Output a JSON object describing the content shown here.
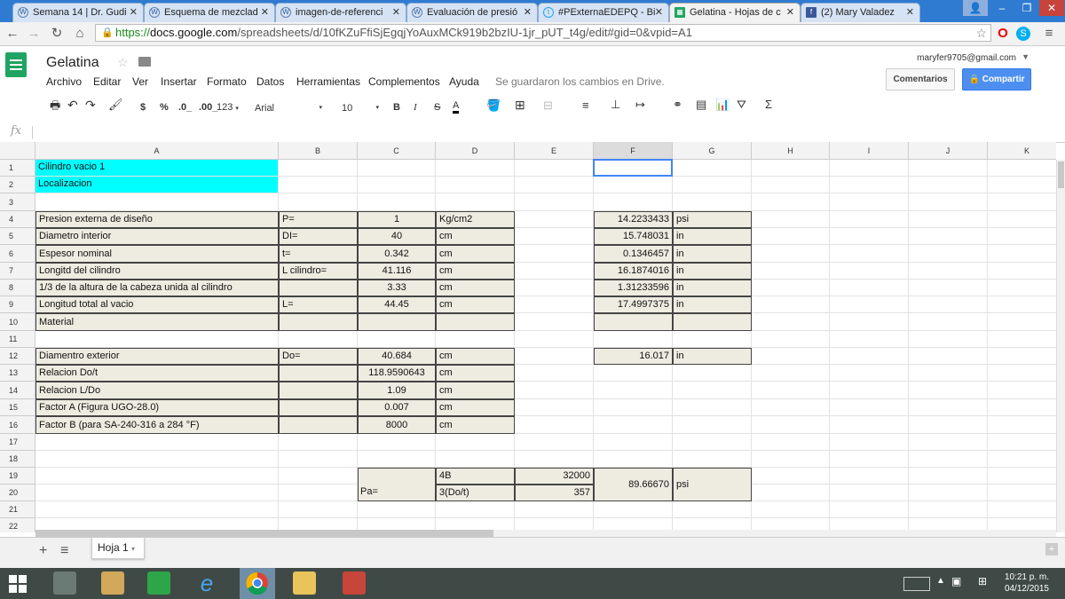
{
  "browser": {
    "tabs": [
      {
        "label": "Semana 14 | Dr. Gudi",
        "icon": "wordpress-icon"
      },
      {
        "label": "Esquema de mezclad",
        "icon": "wordpress-icon"
      },
      {
        "label": "imagen-de-referenci",
        "icon": "wordpress-icon"
      },
      {
        "label": "Evaluación de presió",
        "icon": "wordpress-icon"
      },
      {
        "label": "#PExternaEDEPQ - Bi",
        "icon": "twitter-icon"
      },
      {
        "label": "Gelatina - Hojas de c",
        "icon": "sheets-icon"
      },
      {
        "label": "(2) Mary Valadez",
        "icon": "facebook-icon"
      }
    ],
    "url_scheme": "https://",
    "url_host": "docs.google.com",
    "url_path": "/spreadsheets/d/10fKZuFfiSjEgqjYoAuxMCk919b2bzIU-1jr_pUT_t4g/edit#gid=0&vpid=A1"
  },
  "docs": {
    "title": "Gelatina",
    "menus": [
      "Archivo",
      "Editar",
      "Ver",
      "Insertar",
      "Formato",
      "Datos",
      "Herramientas",
      "Complementos",
      "Ayuda"
    ],
    "save_status": "Se guardaron los cambios en Drive.",
    "user_email": "maryfer9705@gmail.com",
    "comments_label": "Comentarios",
    "share_label": "Compartir"
  },
  "toolbar": {
    "currency": "$",
    "percent": "%",
    "dec_less": ".0_",
    "dec_more": ".00_",
    "more_formats": "123",
    "font": "Arial",
    "font_size": "10",
    "bold": "B",
    "italic": "I",
    "strike": "S",
    "text_color": "A"
  },
  "formula_bar": {
    "label": "fx",
    "value": ""
  },
  "grid": {
    "columns": [
      "A",
      "B",
      "C",
      "D",
      "E",
      "F",
      "G",
      "H",
      "I",
      "J",
      "K"
    ],
    "rows": [
      "1",
      "2",
      "3",
      "4",
      "5",
      "6",
      "7",
      "8",
      "9",
      "10",
      "11",
      "12",
      "13",
      "14",
      "15",
      "16",
      "17",
      "18",
      "19",
      "20",
      "21",
      "22"
    ],
    "A": {
      "r1": "Cilindro vacio 1",
      "r2": "Localizacion",
      "r4": "Presion externa de diseño",
      "r5": "Diametro interior",
      "r6": "Espesor nominal",
      "r7": "Longitd del cilindro",
      "r8": "1/3 de la altura de la cabeza unida al cilindro",
      "r9": "Longitud total al vacio",
      "r10": "Material",
      "r12": "Diamentro exterior",
      "r13": "Relacion Do/t",
      "r14": "Relacion L/Do",
      "r15": "Factor A (Figura UGO-28.0)",
      "r16": "Factor B (para SA-240-316 a 284 °F)"
    },
    "B": {
      "r4": "P=",
      "r5": "DI=",
      "r6": "t=",
      "r7": "L cilindro=",
      "r9": "L=",
      "r12": "Do=",
      "r20": "Pa="
    },
    "C": {
      "r4": "1",
      "r5": "40",
      "r6": "0.342",
      "r7": "41.116",
      "r8": "3.33",
      "r9": "44.45",
      "r12": "40.684",
      "r13": "118.9590643",
      "r14": "1.09",
      "r15": "0.007",
      "r16": "8000"
    },
    "D": {
      "r4": "Kg/cm2",
      "r5": "cm",
      "r6": "cm",
      "r7": "cm",
      "r8": "cm",
      "r9": "cm",
      "r12": "cm",
      "r13": "cm",
      "r14": "cm",
      "r15": "cm",
      "r16": "cm",
      "r19": "4B",
      "r20": "3(Do/t)"
    },
    "E": {
      "r19": "32000",
      "r20": "357"
    },
    "F": {
      "r4": "14.2233433",
      "r5": "15.748031",
      "r6": "0.1346457",
      "r7": "16.1874016",
      "r8": "1.31233596",
      "r9": "17.4997375",
      "r12": "16.017",
      "r19_20": "89.66670"
    },
    "G": {
      "r4": "psi",
      "r5": "in",
      "r6": "in",
      "r7": "in",
      "r8": "in",
      "r9": "in",
      "r12": "in",
      "r19_20": "psi"
    }
  },
  "sheet_tabs": {
    "add": "+",
    "list": "≡",
    "active": "Hoja 1"
  },
  "taskbar": {
    "time": "10:21 p. m.",
    "date": "04/12/2015"
  },
  "colors": {
    "accent": "#4d8ff0",
    "cyan_fill": "#00ffff",
    "tan_fill": "#eeece1",
    "sheets_green": "#1fa463"
  }
}
